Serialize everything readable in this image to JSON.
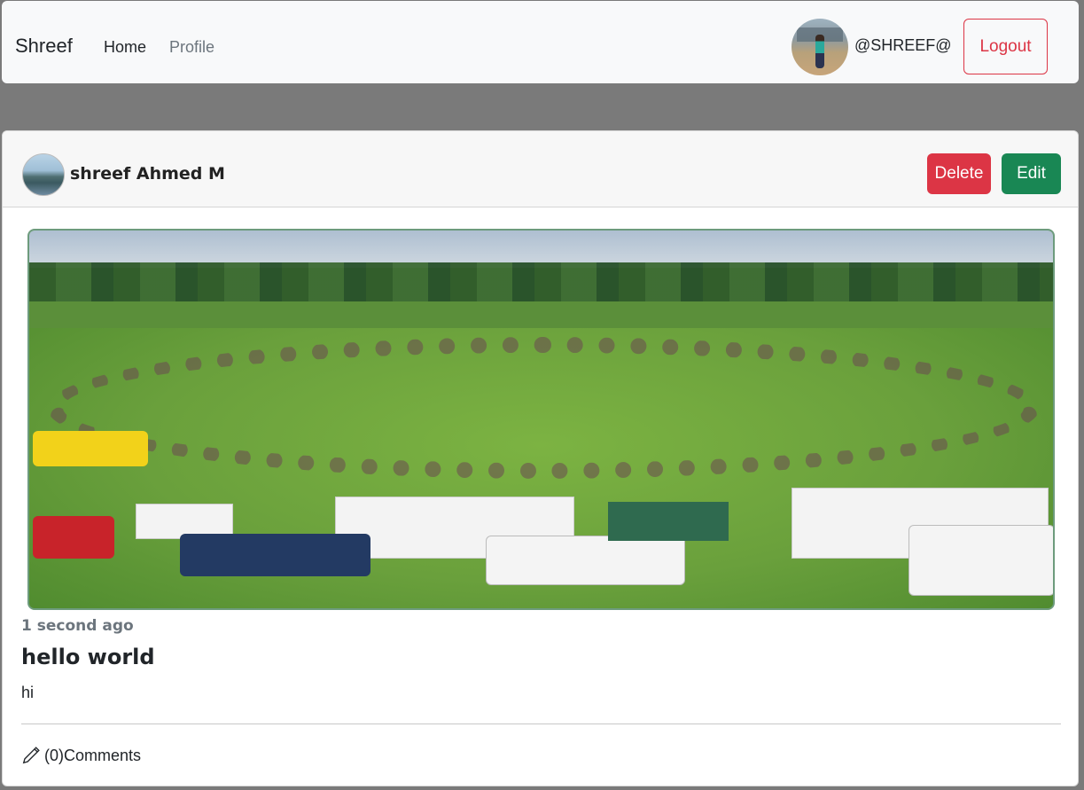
{
  "navbar": {
    "brand": "Shreef",
    "links": [
      {
        "label": "Home",
        "active": true
      },
      {
        "label": "Profile",
        "active": false
      }
    ],
    "username": "@SHREEF@",
    "logout_label": "Logout"
  },
  "post": {
    "author": "shreef Ahmed M",
    "delete_label": "Delete",
    "edit_label": "Edit",
    "timestamp": "1 second ago",
    "title": "hello world",
    "body": "hi",
    "comments_label": "(0)Comments"
  },
  "colors": {
    "danger": "#dc3545",
    "success": "#198754",
    "muted": "#6c757d",
    "backdrop": "#7a7a7a"
  },
  "icons": {
    "comments": "pencil-icon"
  }
}
